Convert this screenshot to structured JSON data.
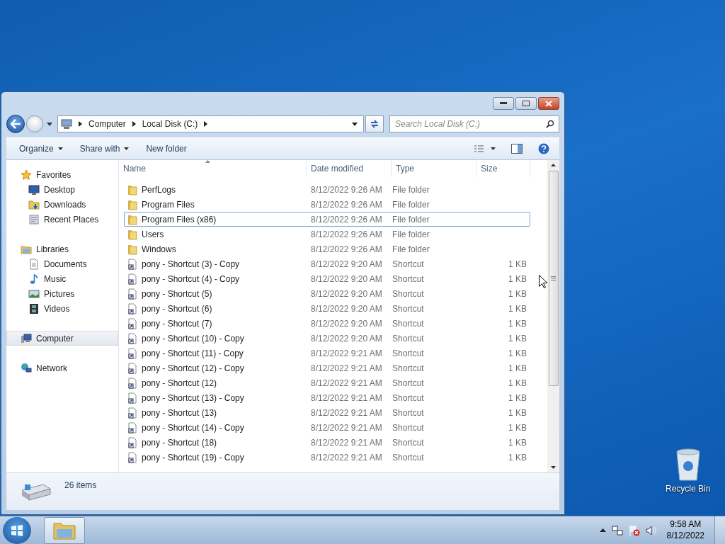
{
  "window": {
    "address": [
      "Computer",
      "Local Disk (C:)"
    ],
    "search": {
      "placeholder": "Search Local Disk (C:)"
    },
    "toolbar": [
      {
        "label": "Organize",
        "dropdown": true
      },
      {
        "label": "Share with",
        "dropdown": true
      },
      {
        "label": "New folder",
        "dropdown": false
      }
    ],
    "sidebar": [
      {
        "label": "Favorites",
        "kind": "star",
        "selected": false,
        "children": [
          {
            "label": "Desktop",
            "kind": "monitor",
            "selected": false
          },
          {
            "label": "Downloads",
            "kind": "download",
            "selected": false
          },
          {
            "label": "Recent Places",
            "kind": "recent",
            "selected": false
          }
        ]
      },
      {
        "label": "Libraries",
        "kind": "library",
        "selected": false,
        "children": [
          {
            "label": "Documents",
            "kind": "document",
            "selected": false
          },
          {
            "label": "Music",
            "kind": "music",
            "selected": false
          },
          {
            "label": "Pictures",
            "kind": "picture",
            "selected": false
          },
          {
            "label": "Videos",
            "kind": "video",
            "selected": false
          }
        ]
      },
      {
        "label": "Computer",
        "kind": "computer",
        "selected": true
      },
      {
        "label": "Network",
        "kind": "network",
        "selected": false
      }
    ],
    "columns": [
      {
        "label": "Name",
        "sorted": true
      },
      {
        "label": "Date modified",
        "sorted": false
      },
      {
        "label": "Type",
        "sorted": false
      },
      {
        "label": "Size",
        "sorted": false
      }
    ],
    "rows": [
      {
        "kind": "folder",
        "name": "PerfLogs",
        "date": "8/12/2022 9:26 AM",
        "type": "File folder",
        "selected": false
      },
      {
        "kind": "folder",
        "name": "Program Files",
        "date": "8/12/2022 9:26 AM",
        "type": "File folder",
        "selected": false
      },
      {
        "kind": "folder",
        "name": "Program Files (x86)",
        "date": "8/12/2022 9:26 AM",
        "type": "File folder",
        "selected": true
      },
      {
        "kind": "folder",
        "name": "Users",
        "date": "8/12/2022 9:26 AM",
        "type": "File folder",
        "selected": false
      },
      {
        "kind": "folder",
        "name": "Windows",
        "date": "8/12/2022 9:26 AM",
        "type": "File folder",
        "selected": false
      },
      {
        "kind": "shortcut",
        "name": "pony - Shortcut (3) - Copy",
        "date": "8/12/2022 9:20 AM",
        "type": "Shortcut",
        "size": "1 KB",
        "selected": false
      },
      {
        "kind": "shortcut",
        "name": "pony - Shortcut (4) - Copy",
        "date": "8/12/2022 9:20 AM",
        "type": "Shortcut",
        "size": "1 KB",
        "selected": false
      },
      {
        "kind": "shortcut",
        "name": "pony - Shortcut (5)",
        "date": "8/12/2022 9:20 AM",
        "type": "Shortcut",
        "size": "1 KB",
        "selected": false
      },
      {
        "kind": "shortcut",
        "name": "pony - Shortcut (6)",
        "date": "8/12/2022 9:20 AM",
        "type": "Shortcut",
        "size": "1 KB",
        "selected": false
      },
      {
        "kind": "shortcut",
        "name": "pony - Shortcut (7)",
        "date": "8/12/2022 9:20 AM",
        "type": "Shortcut",
        "size": "1 KB",
        "selected": false
      },
      {
        "kind": "shortcut",
        "name": "pony - Shortcut (10) - Copy",
        "date": "8/12/2022 9:20 AM",
        "type": "Shortcut",
        "size": "1 KB",
        "selected": false
      },
      {
        "kind": "shortcut",
        "name": "pony - Shortcut (11) - Copy",
        "date": "8/12/2022 9:21 AM",
        "type": "Shortcut",
        "size": "1 KB",
        "selected": false
      },
      {
        "kind": "shortcut",
        "name": "pony - Shortcut (12) - Copy",
        "date": "8/12/2022 9:21 AM",
        "type": "Shortcut",
        "size": "1 KB",
        "selected": false
      },
      {
        "kind": "shortcut",
        "name": "pony - Shortcut (12)",
        "date": "8/12/2022 9:21 AM",
        "type": "Shortcut",
        "size": "1 KB",
        "selected": false
      },
      {
        "kind": "shortcut",
        "name": "pony - Shortcut (13) - Copy",
        "date": "8/12/2022 9:21 AM",
        "type": "Shortcut",
        "size": "1 KB",
        "selected": false
      },
      {
        "kind": "shortcut",
        "name": "pony - Shortcut (13)",
        "date": "8/12/2022 9:21 AM",
        "type": "Shortcut",
        "size": "1 KB",
        "selected": false
      },
      {
        "kind": "shortcut",
        "name": "pony - Shortcut (14) - Copy",
        "date": "8/12/2022 9:21 AM",
        "type": "Shortcut",
        "size": "1 KB",
        "selected": false
      },
      {
        "kind": "shortcut",
        "name": "pony - Shortcut (18)",
        "date": "8/12/2022 9:21 AM",
        "type": "Shortcut",
        "size": "1 KB",
        "selected": false
      },
      {
        "kind": "shortcut",
        "name": "pony - Shortcut (19) - Copy",
        "date": "8/12/2022 9:21 AM",
        "type": "Shortcut",
        "size": "1 KB",
        "selected": false
      }
    ],
    "status": "26 items"
  },
  "desktop_icons": [
    {
      "label": "Recycle Bin"
    }
  ],
  "taskbar": {
    "time": "9:58 AM",
    "date": "8/12/2022"
  }
}
